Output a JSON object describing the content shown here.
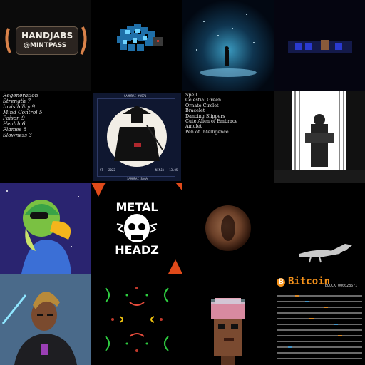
{
  "gallery": {
    "tiles": [
      {
        "name": "handjabs-mintpass",
        "title": "HANDJABS",
        "subtitle": "@MINTPASS"
      },
      {
        "name": "pixel-fish"
      },
      {
        "name": "cosmic-figure"
      },
      {
        "name": "pixel-dark-scene"
      },
      {
        "name": "attribute-stats"
      },
      {
        "name": "samurai-card",
        "header": "SAMURAI #0571",
        "left_label": "ST · 2022",
        "right_label": "NINJA · 13.05",
        "footer": "SAMURAI SAGA"
      },
      {
        "name": "item-list"
      },
      {
        "name": "comic-street"
      },
      {
        "name": "parrot-pilot"
      },
      {
        "name": "metal-headz",
        "line1": "METAL",
        "line2": "HEADZ"
      },
      {
        "name": "planet"
      },
      {
        "name": "dinosaur"
      },
      {
        "name": "cyber-warrior"
      },
      {
        "name": "kaleidoscope"
      },
      {
        "name": "pixel-brain-punk"
      },
      {
        "name": "bitcoin-block",
        "title": "Bitcoin",
        "block": "BLOCK 000028671"
      }
    ]
  },
  "stats": [
    "Regeneration",
    "Strength 7",
    "Invisibility 9",
    "Mind Control 5",
    "Poison 9",
    "Health 6",
    "Flames 8",
    "Slowness 3"
  ],
  "items": [
    "Spell",
    "Celestial Green",
    "Ornate Circlet",
    "Bracelet",
    "Dancing Slippers",
    "Cute Alien of Embrace",
    "Amulet",
    "Pen of Intelligence"
  ],
  "colors": {
    "background": "#000000",
    "bitcoin": "#f7931a",
    "samurai_bg": "#0f1730"
  }
}
